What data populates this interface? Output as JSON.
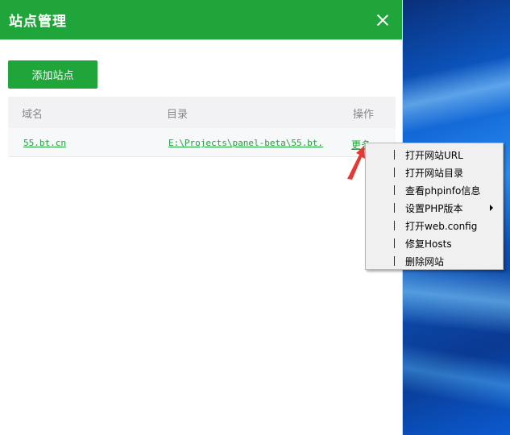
{
  "dialog": {
    "title": "站点管理",
    "add_site_label": "添加站点"
  },
  "table": {
    "headers": [
      "域名",
      "目录",
      "操作"
    ],
    "rows": [
      {
        "domain": "55.bt.cn",
        "path": "E:\\Projects\\panel-beta\\55.bt.",
        "action": "更多"
      }
    ]
  },
  "context_menu": {
    "items": [
      {
        "label": "打开网站URL",
        "submenu": false
      },
      {
        "label": "打开网站目录",
        "submenu": false
      },
      {
        "label": "查看phpinfo信息",
        "submenu": false
      },
      {
        "label": "设置PHP版本",
        "submenu": true
      },
      {
        "label": "打开web.config",
        "submenu": false
      },
      {
        "label": "修复Hosts",
        "submenu": false
      },
      {
        "label": "删除网站",
        "submenu": false
      }
    ]
  },
  "colors": {
    "brand_green": "#20a53a",
    "annotation_arrow": "#e53935"
  },
  "icons": {
    "close": "close-icon",
    "submenu": "chevron-right-icon",
    "annotation": "arrow-annotation-icon"
  }
}
